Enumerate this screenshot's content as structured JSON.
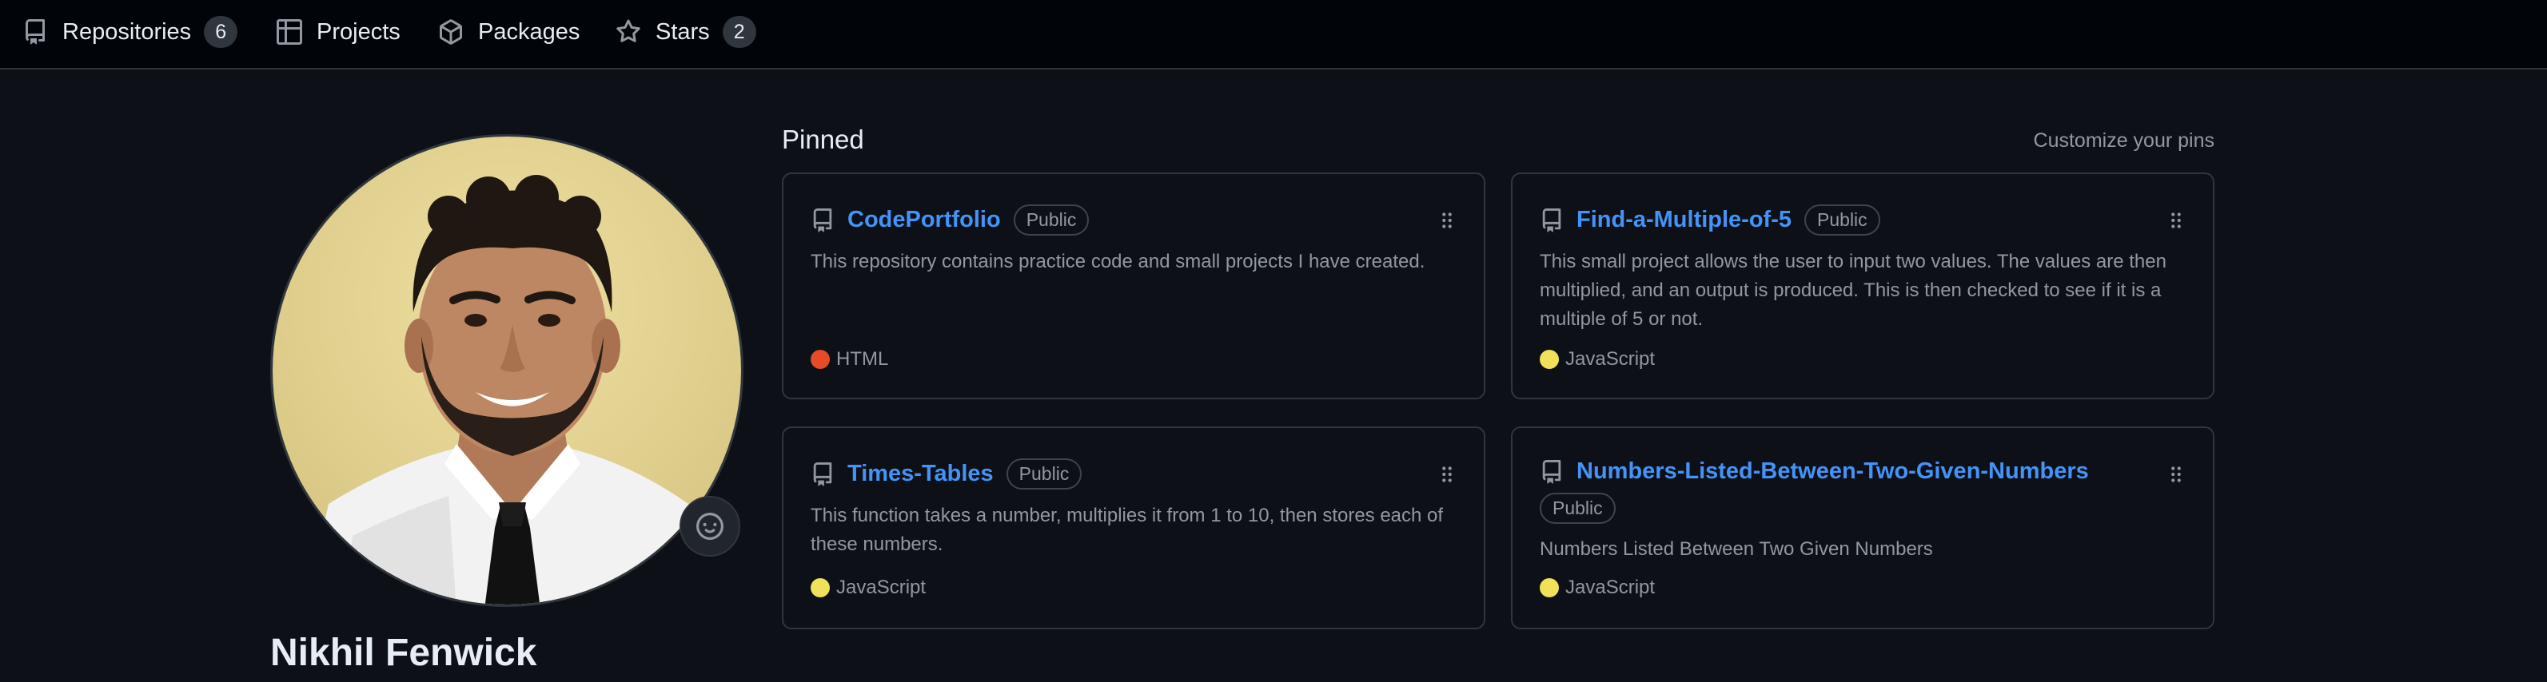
{
  "nav": {
    "items": [
      {
        "label": "Repositories",
        "count": "6",
        "icon": "repo-icon"
      },
      {
        "label": "Projects",
        "icon": "table-icon"
      },
      {
        "label": "Packages",
        "icon": "package-icon"
      },
      {
        "label": "Stars",
        "count": "2",
        "icon": "star-icon"
      }
    ]
  },
  "profile": {
    "name": "Nikhil Fenwick",
    "status_icon": "smiley-icon"
  },
  "pinned": {
    "title": "Pinned",
    "customize_label": "Customize your pins",
    "repos": [
      {
        "name": "CodePortfolio",
        "visibility": "Public",
        "description": "This repository contains practice code and small projects I have created.",
        "language": "HTML",
        "language_color": "#e34c26"
      },
      {
        "name": "Find-a-Multiple-of-5",
        "visibility": "Public",
        "description": "This small project allows the user to input two values. The values are then multiplied, and an output is produced. This is then checked to see if it is a multiple of 5 or not.",
        "language": "JavaScript",
        "language_color": "#f1e05a"
      },
      {
        "name": "Times-Tables",
        "visibility": "Public",
        "description": "This function takes a number, multiplies it from 1 to 10, then stores each of these numbers.",
        "language": "JavaScript",
        "language_color": "#f1e05a"
      },
      {
        "name": "Numbers-Listed-Between-Two-Given-Numbers",
        "visibility": "Public",
        "description": "Numbers Listed Between Two Given Numbers",
        "language": "JavaScript",
        "language_color": "#f1e05a"
      }
    ]
  },
  "colors": {
    "background": "#0d1117",
    "link": "#4493f8",
    "muted": "#9198a1",
    "border": "#30363d"
  }
}
